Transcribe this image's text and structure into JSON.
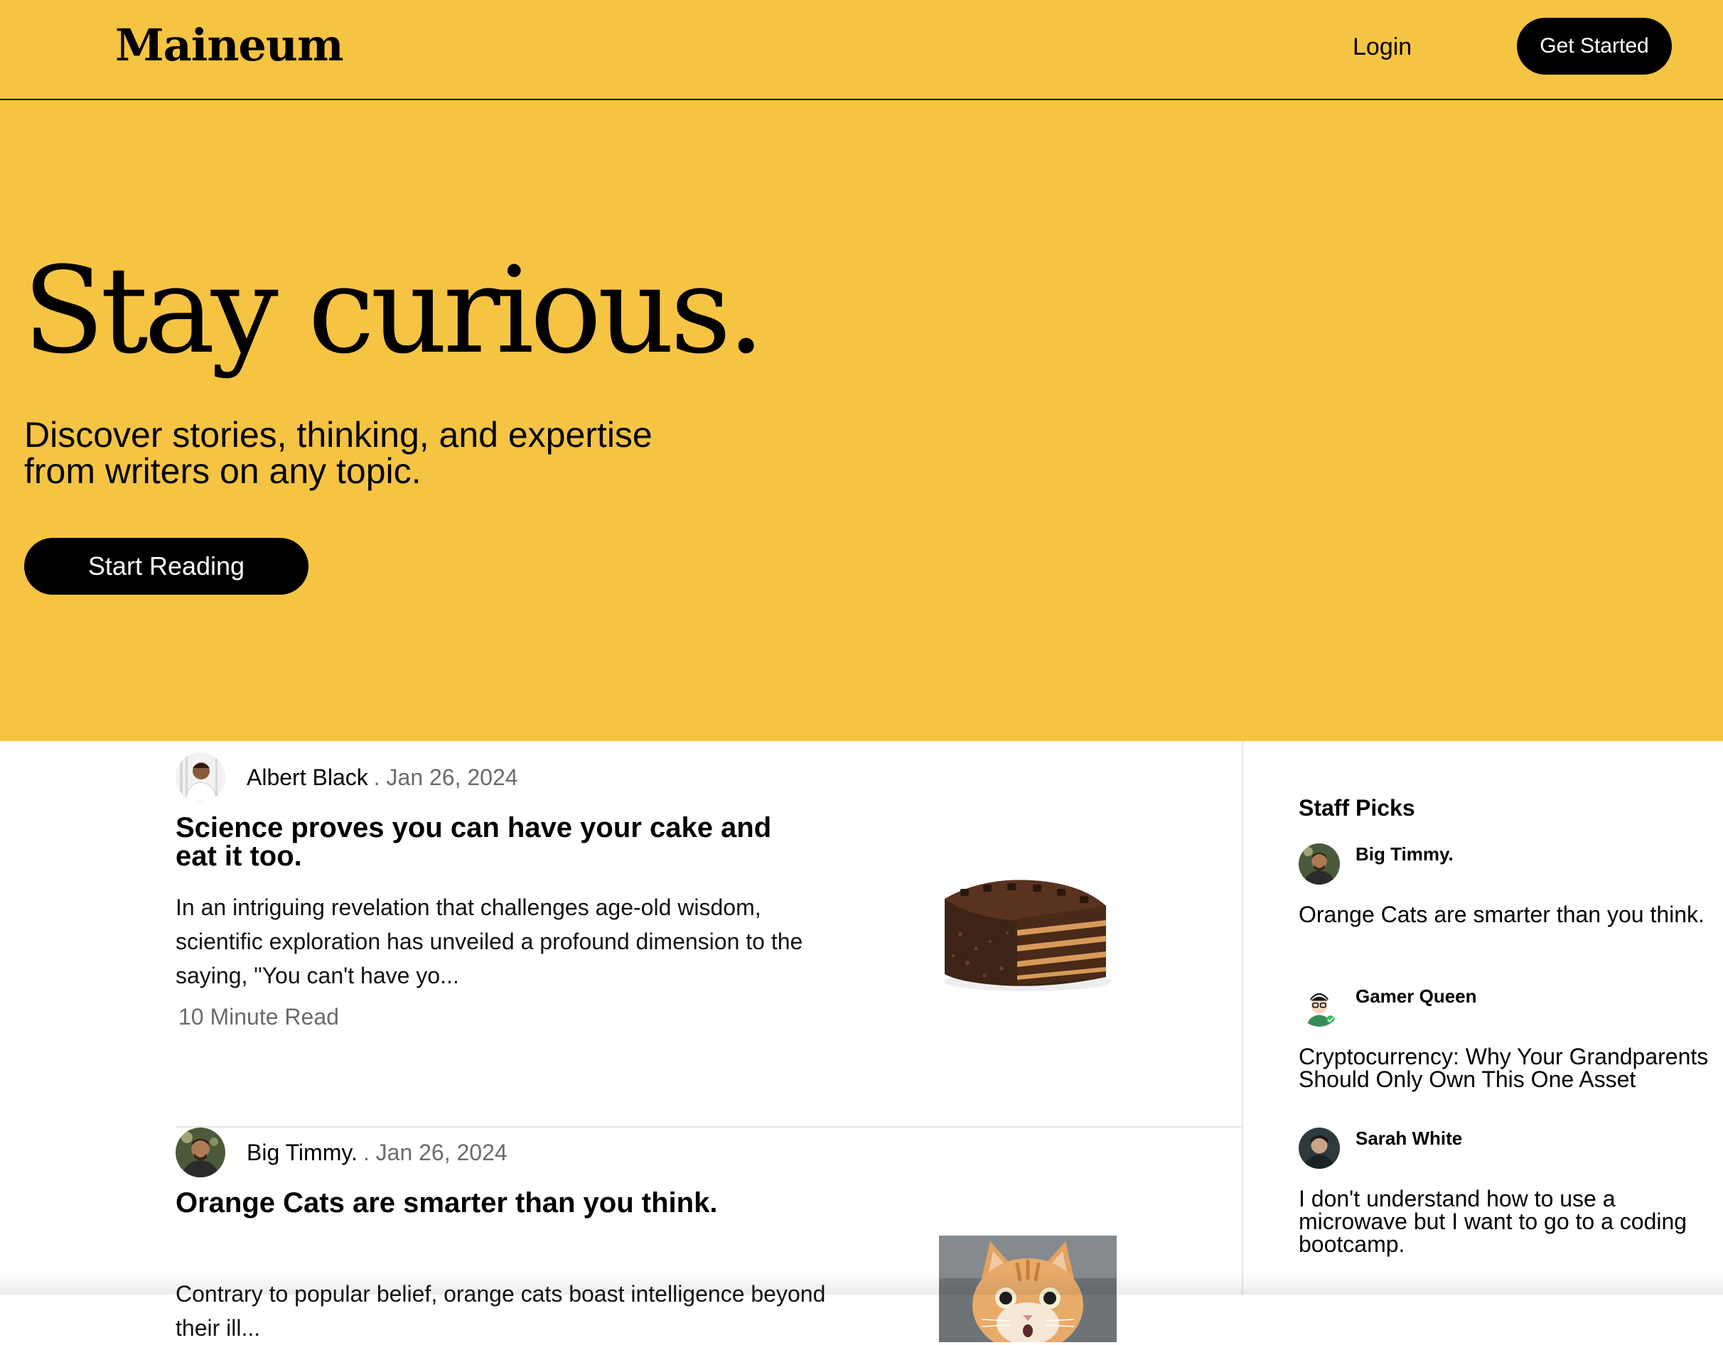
{
  "header": {
    "logo": "Maineum",
    "login_label": "Login",
    "get_started_label": "Get Started"
  },
  "hero": {
    "title": "Stay curious.",
    "subtitle": "Discover stories, thinking, and expertise from writers on any topic.",
    "cta_label": "Start Reading"
  },
  "articles": [
    {
      "author": "Albert Black",
      "date": ". Jan 26, 2024",
      "title": "Science proves you can have your cake and eat it too.",
      "excerpt": "In an intriguing revelation that challenges age-old wisdom, scientific exploration has unveiled a profound dimension to the saying, \"You can't have yo...",
      "read_time": "10 Minute Read",
      "thumbnail": "chocolate-cake-image"
    },
    {
      "author": "Big Timmy.",
      "date": ". Jan 26, 2024",
      "title": "Orange Cats are smarter than you think.",
      "excerpt": "Contrary to popular belief, orange cats boast intelligence beyond their ill...",
      "thumbnail": "orange-cat-image"
    }
  ],
  "staff_picks": {
    "heading": "Staff Picks",
    "items": [
      {
        "author": "Big Timmy.",
        "title": "Orange Cats are smarter than you think."
      },
      {
        "author": "Gamer Queen",
        "title": "Cryptocurrency: Why Your Grandparents Should Only Own This One Asset"
      },
      {
        "author": "Sarah White",
        "title": "I don't understand how to use a microwave but I want to go to a coding bootcamp."
      }
    ]
  },
  "colors": {
    "brand_yellow": "#F5C443",
    "button_black": "#000000",
    "muted_text": "#6b6b6b",
    "divider": "#e6e6e6"
  }
}
